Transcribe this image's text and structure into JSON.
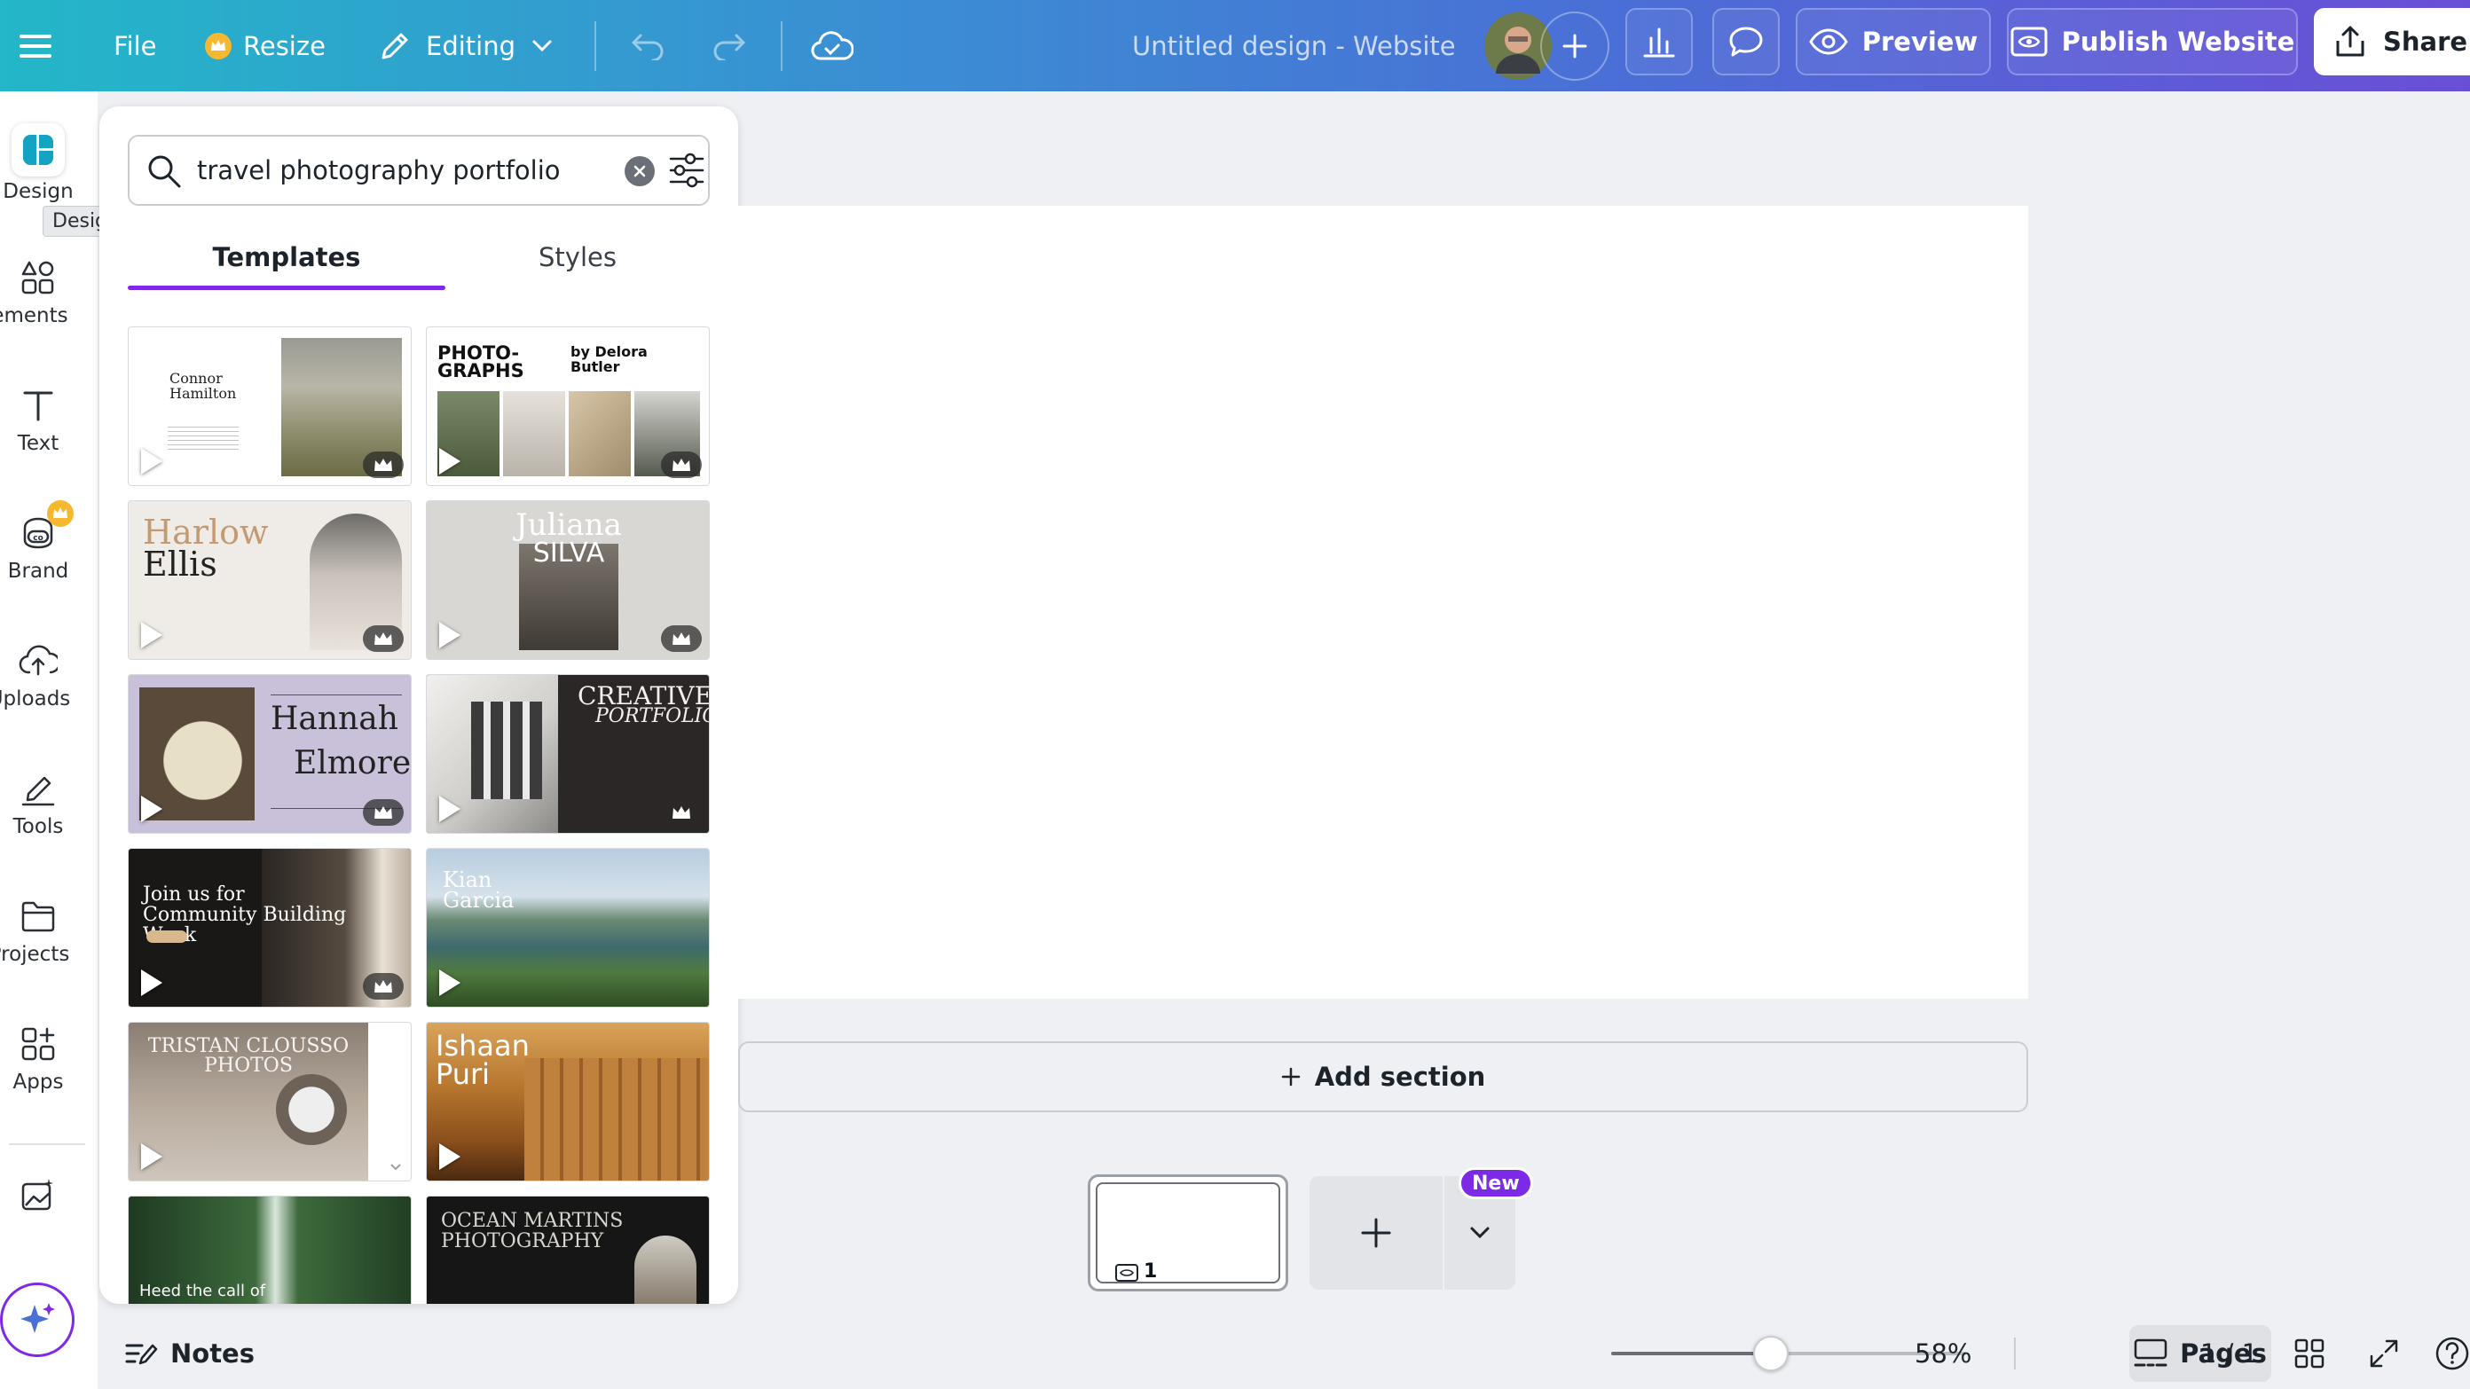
{
  "topbar": {
    "file_label": "File",
    "resize_label": "Resize",
    "editing_label": "Editing",
    "doc_title": "Untitled design - Website",
    "preview_label": "Preview",
    "publish_label": "Publish Website",
    "share_label": "Share"
  },
  "rail": {
    "items": [
      {
        "label": "Design",
        "icon": "design-icon"
      },
      {
        "label": "Elements",
        "icon": "elements-icon"
      },
      {
        "label": "Text",
        "icon": "text-icon"
      },
      {
        "label": "Brand",
        "icon": "brand-icon"
      },
      {
        "label": "Uploads",
        "icon": "uploads-icon"
      },
      {
        "label": "Tools",
        "icon": "tools-icon"
      },
      {
        "label": "Projects",
        "icon": "projects-icon"
      },
      {
        "label": "Apps",
        "icon": "apps-icon"
      }
    ],
    "tooltip": "Design"
  },
  "panel": {
    "search_value": "travel photography portfolio",
    "tabs": [
      "Templates",
      "Styles"
    ],
    "active_tab": "Templates",
    "templates": [
      {
        "title": "Connor Hamilton"
      },
      {
        "title": "PHOTO-GRAPHS",
        "byline": "by Delora Butler"
      },
      {
        "title": "Harlow",
        "title2": "Ellis"
      },
      {
        "title": "Juliana",
        "title2": "SILVA"
      },
      {
        "title": "Hannah",
        "title2": "Elmore"
      },
      {
        "title": "CREATIVE",
        "title2": "PORTFOLIO"
      },
      {
        "title": "Join us for Community Building Week"
      },
      {
        "title": "Kian",
        "title2": "Garcia"
      },
      {
        "title": "TRISTAN CLOUSSO PHOTOS"
      },
      {
        "title": "Ishaan",
        "title2": "Puri"
      },
      {
        "title": "Heed the call of"
      },
      {
        "title": "OCEAN MARTINS PHOTOGRAPHY"
      }
    ]
  },
  "canvas": {
    "add_section_label": "Add section"
  },
  "pages_strip": {
    "page_number": "1",
    "new_badge": "New"
  },
  "bottombar": {
    "notes_label": "Notes",
    "zoom_percent": "58%",
    "zoom_value": 0.58,
    "pages_label": "Pages",
    "page_count": "1 / 1"
  },
  "colors": {
    "accent": "#7d2ae8"
  }
}
